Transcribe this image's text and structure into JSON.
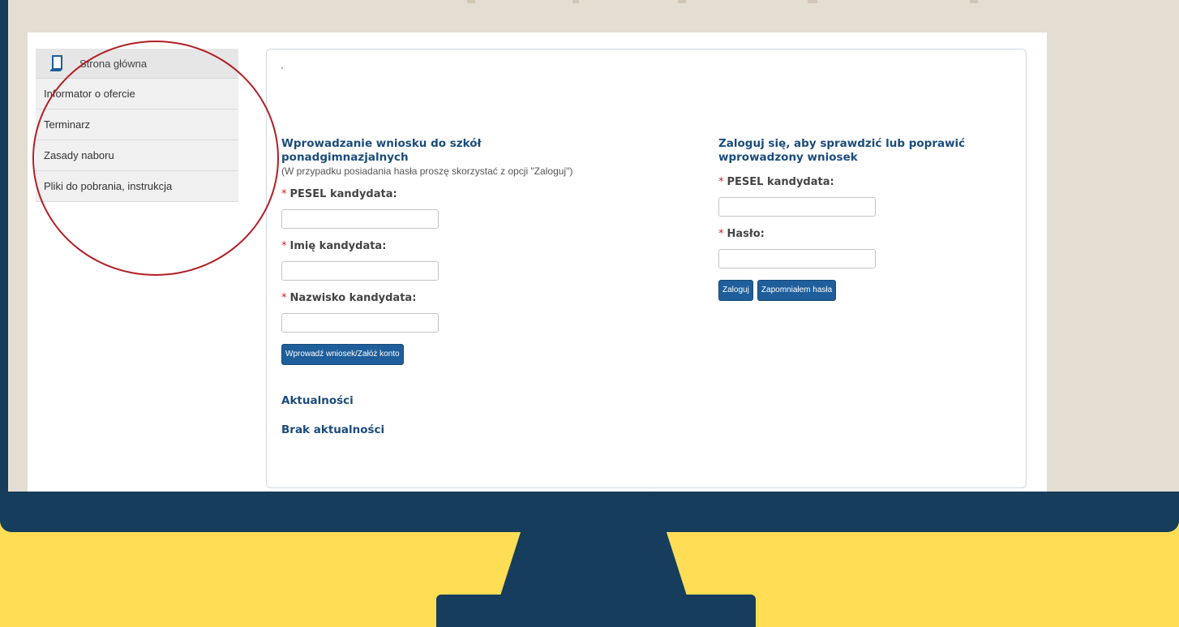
{
  "sidebar": {
    "home": {
      "label": "Strona główna",
      "icon": "document-icon"
    },
    "items": [
      {
        "label": "Informator o ofercie"
      },
      {
        "label": "Terminarz"
      },
      {
        "label": "Zasady naboru"
      },
      {
        "label": "Pliki do pobrania, instrukcja"
      }
    ]
  },
  "application": {
    "title": "Wprowadzanie wniosku do szkół ponadgimnazjalnych",
    "note": "(W przypadku posiadania hasła proszę skorzystać z opcji \"Zaloguj\")",
    "fields": {
      "pesel_label": "PESEL kandydata:",
      "first_name_label": "Imię kandydata:",
      "last_name_label": "Nazwisko kandydata:"
    },
    "submit_label": "Wprowadź wniosek/Załóż konto"
  },
  "login": {
    "title": "Zaloguj się, aby sprawdzić lub poprawić wprowadzony wniosek",
    "fields": {
      "pesel_label": "PESEL kandydata:",
      "password_label": "Hasło:"
    },
    "login_label": "Zaloguj",
    "forgot_label": "Zapomniałem hasła"
  },
  "news": {
    "title": "Aktualności",
    "empty": "Brak aktualności"
  },
  "colors": {
    "monitor": "#163d5c",
    "background": "#ffdd55",
    "accent": "#1a4c7c",
    "button": "#1e5e9a",
    "annotation": "#b21e24"
  }
}
